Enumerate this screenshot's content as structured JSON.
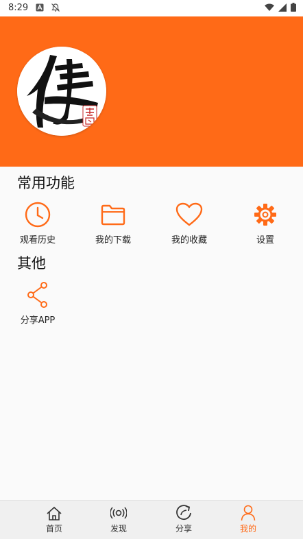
{
  "status_bar": {
    "time": "8:29"
  },
  "sections": {
    "common": {
      "title": "常用功能",
      "items": [
        {
          "label": "观看历史",
          "icon": "clock-icon"
        },
        {
          "label": "我的下载",
          "icon": "folder-icon"
        },
        {
          "label": "我的收藏",
          "icon": "heart-icon"
        },
        {
          "label": "设置",
          "icon": "gear-icon"
        }
      ]
    },
    "other": {
      "title": "其他",
      "items": [
        {
          "label": "分享APP",
          "icon": "share-icon"
        }
      ]
    }
  },
  "tabs": [
    {
      "label": "首页",
      "icon": "home-icon",
      "active": false
    },
    {
      "label": "发现",
      "icon": "broadcast-icon",
      "active": false
    },
    {
      "label": "分享",
      "icon": "refresh-share-icon",
      "active": false
    },
    {
      "label": "我的",
      "icon": "person-icon",
      "active": true
    }
  ],
  "colors": {
    "accent": "#ff6a17",
    "background": "#fafafa",
    "tabbar": "#f0f0f0"
  },
  "avatar": {
    "stamp_text": "美剧"
  }
}
